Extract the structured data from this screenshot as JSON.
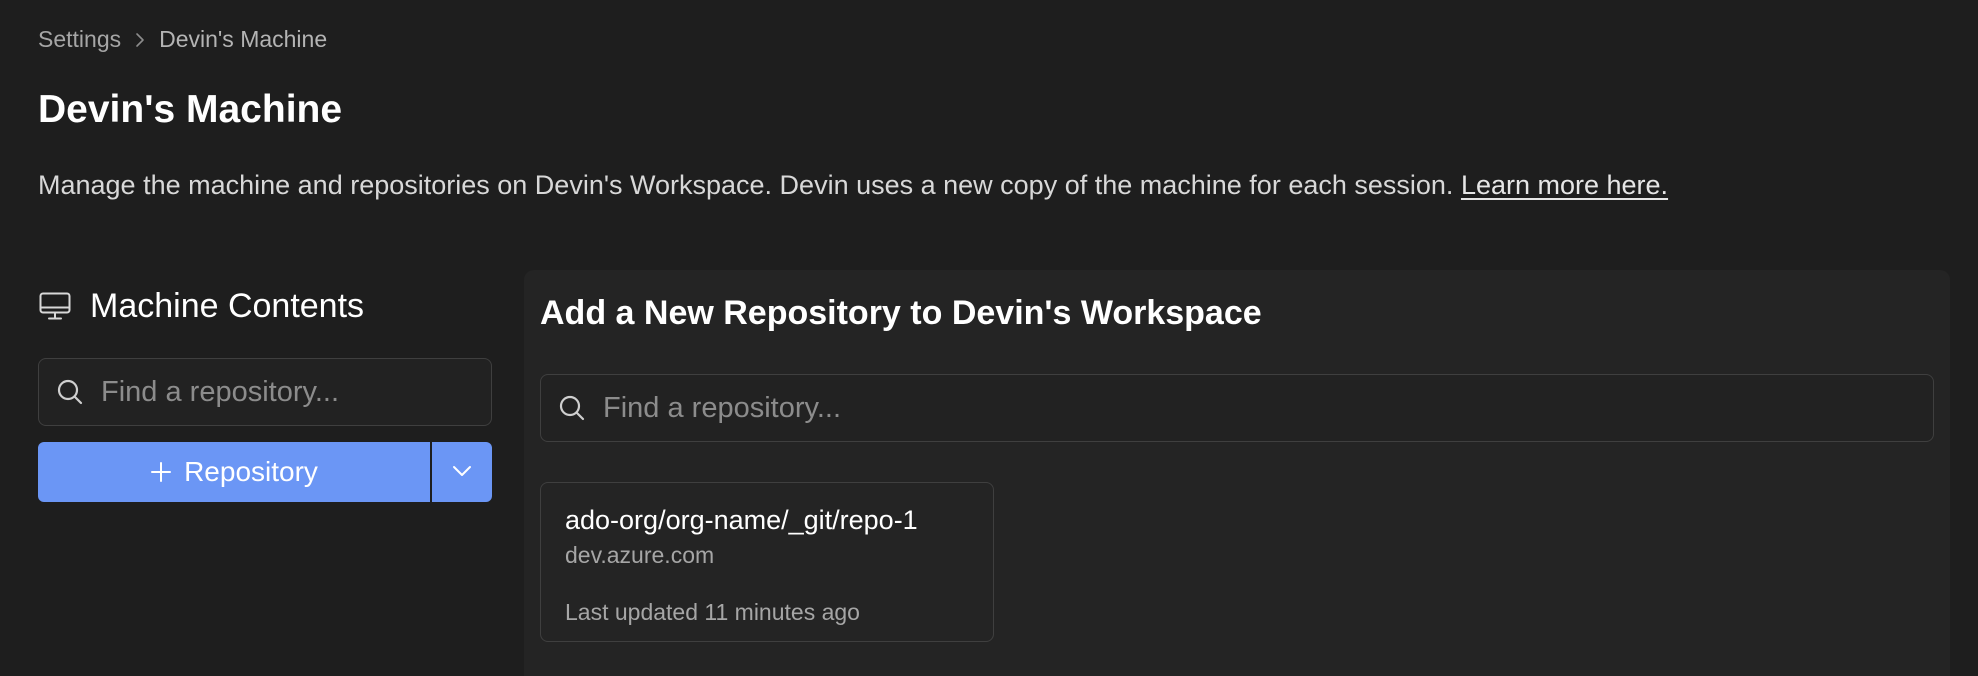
{
  "breadcrumb": {
    "items": [
      "Settings",
      "Devin's Machine"
    ]
  },
  "page": {
    "title": "Devin's Machine",
    "description": "Manage the machine and repositories on Devin's Workspace. Devin uses a new copy of the machine for each session.",
    "learn_more_link": "Learn more here."
  },
  "machine_contents": {
    "title": "Machine Contents",
    "icon": "monitor-icon",
    "search_placeholder": "Find a repository...",
    "add_button_label": "Repository",
    "add_button_icon": "plus-icon",
    "dropdown_icon": "chevron-down-icon"
  },
  "add_repo_panel": {
    "title": "Add a New Repository to Devin's Workspace",
    "search_placeholder": "Find a repository...",
    "repositories": [
      {
        "name": "ado-org/org-name/_git/repo-1",
        "host": "dev.azure.com",
        "updated": "Last updated 11 minutes ago"
      }
    ]
  },
  "colors": {
    "background": "#1e1e1e",
    "panel": "#242424",
    "accent": "#6b96f5",
    "border": "#3f3f3f"
  }
}
